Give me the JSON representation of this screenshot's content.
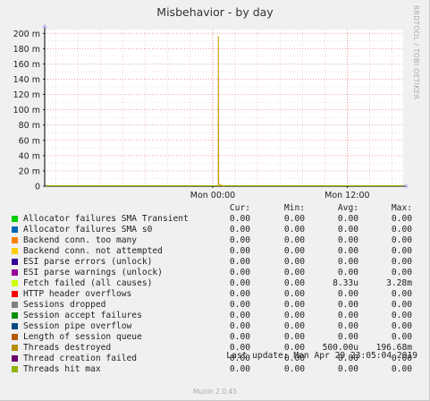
{
  "chart_data": {
    "type": "line",
    "title": "Misbehavior - by day",
    "y_ticks": [
      "0",
      "20 m",
      "40 m",
      "60 m",
      "80 m",
      "100 m",
      "120 m",
      "140 m",
      "160 m",
      "180 m",
      "200 m"
    ],
    "y_tick_values": [
      0,
      0.02,
      0.04,
      0.06,
      0.08,
      0.1,
      0.12,
      0.14,
      0.16,
      0.18,
      0.2
    ],
    "ylim": [
      0,
      0.205
    ],
    "x_ticks": [
      "Mon 00:00",
      "Mon 12:00"
    ],
    "x_tick_hours": [
      24,
      36
    ],
    "xlim_hours": [
      9,
      41
    ],
    "grid": true,
    "spike": {
      "series": "Threads destroyed",
      "color": "#cc9900",
      "hour": 24.5,
      "points": [
        [
          24.49,
          0
        ],
        [
          24.5,
          0.1967
        ],
        [
          24.53,
          0.003
        ],
        [
          24.8,
          0.001
        ],
        [
          25.0,
          0
        ]
      ]
    },
    "series_stats_columns": [
      "Cur:",
      "Min:",
      "Avg:",
      "Max:"
    ],
    "series": [
      {
        "name": "Allocator failures SMA Transient",
        "color": "#00cc00",
        "cur": "0.00",
        "min": "0.00",
        "avg": "0.00",
        "max": "0.00"
      },
      {
        "name": "Allocator failures SMA s0",
        "color": "#0066b3",
        "cur": "0.00",
        "min": "0.00",
        "avg": "0.00",
        "max": "0.00"
      },
      {
        "name": "Backend conn. too many",
        "color": "#ff8000",
        "cur": "0.00",
        "min": "0.00",
        "avg": "0.00",
        "max": "0.00"
      },
      {
        "name": "Backend conn. not attempted",
        "color": "#ffcc00",
        "cur": "0.00",
        "min": "0.00",
        "avg": "0.00",
        "max": "0.00"
      },
      {
        "name": "ESI parse errors (unlock)",
        "color": "#330099",
        "cur": "0.00",
        "min": "0.00",
        "avg": "0.00",
        "max": "0.00"
      },
      {
        "name": "ESI parse warnings (unlock)",
        "color": "#990099",
        "cur": "0.00",
        "min": "0.00",
        "avg": "0.00",
        "max": "0.00"
      },
      {
        "name": "Fetch failed (all causes)",
        "color": "#ccff00",
        "cur": "0.00",
        "min": "0.00",
        "avg": "8.33u",
        "max": "3.28m"
      },
      {
        "name": "HTTP header overflows",
        "color": "#ff0000",
        "cur": "0.00",
        "min": "0.00",
        "avg": "0.00",
        "max": "0.00"
      },
      {
        "name": "Sessions dropped",
        "color": "#808080",
        "cur": "0.00",
        "min": "0.00",
        "avg": "0.00",
        "max": "0.00"
      },
      {
        "name": "Session accept failures",
        "color": "#008f00",
        "cur": "0.00",
        "min": "0.00",
        "avg": "0.00",
        "max": "0.00"
      },
      {
        "name": "Session pipe overflow",
        "color": "#00487d",
        "cur": "0.00",
        "min": "0.00",
        "avg": "0.00",
        "max": "0.00"
      },
      {
        "name": "Length of session queue",
        "color": "#b35a00",
        "cur": "0.00",
        "min": "0.00",
        "avg": "0.00",
        "max": "0.00"
      },
      {
        "name": "Threads destroyed",
        "color": "#b38f00",
        "cur": "0.00",
        "min": "0.00",
        "avg": "500.00u",
        "max": "196.68m"
      },
      {
        "name": "Thread creation failed",
        "color": "#6b006b",
        "cur": "0.00",
        "min": "0.00",
        "avg": "0.00",
        "max": "0.00"
      },
      {
        "name": "Threads hit max",
        "color": "#8fb300",
        "cur": "0.00",
        "min": "0.00",
        "avg": "0.00",
        "max": "0.00"
      }
    ]
  },
  "side_label": "RRDTOOL / TOBI OETIKER",
  "last_update": "Last update: Mon Apr 29 23:05:04 2019",
  "footer": "Munin 2.0.45"
}
